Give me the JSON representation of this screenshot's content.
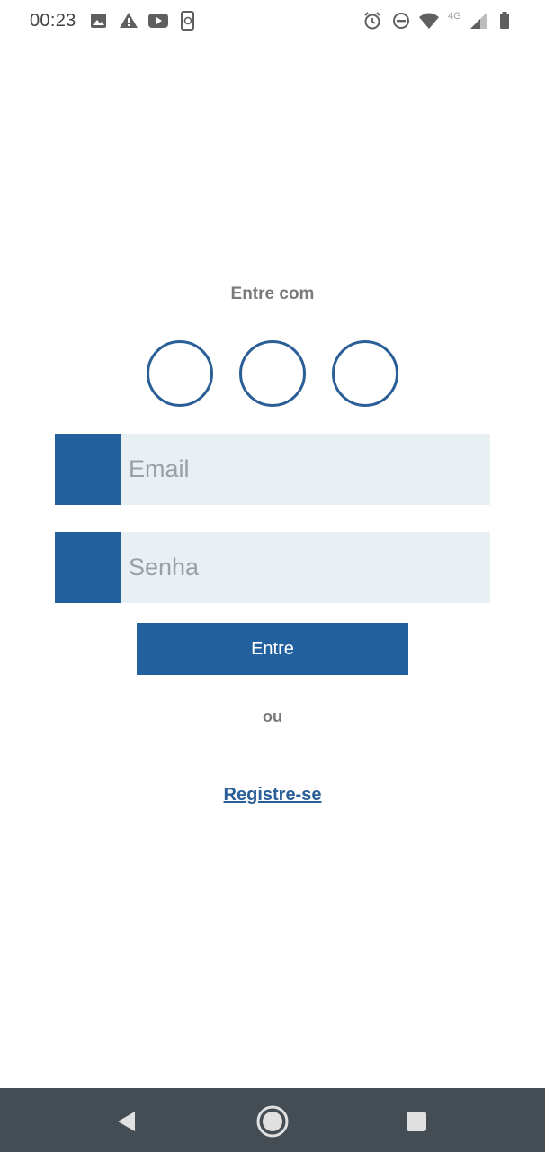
{
  "status_bar": {
    "time": "00:23",
    "network": "4G",
    "icons": [
      "image-icon",
      "warning-icon",
      "youtube-icon",
      "phone-sync-icon",
      "alarm-icon",
      "do-not-disturb-icon",
      "wifi-icon",
      "signal-icon",
      "battery-icon"
    ]
  },
  "login": {
    "heading": "Entre com",
    "social_buttons": [
      "social-login-1",
      "social-login-2",
      "social-login-3"
    ],
    "email_placeholder": "Email",
    "password_placeholder": "Senha",
    "submit_label": "Entre",
    "separator": "ou",
    "register_link": "Registre-se"
  },
  "colors": {
    "primary": "#22609e",
    "field_background": "#e8f0f4",
    "muted_text": "#7a7a7a",
    "nav_bar": "#444d54"
  },
  "nav_bar": {
    "buttons": [
      "back-icon",
      "home-icon",
      "recents-icon"
    ]
  }
}
